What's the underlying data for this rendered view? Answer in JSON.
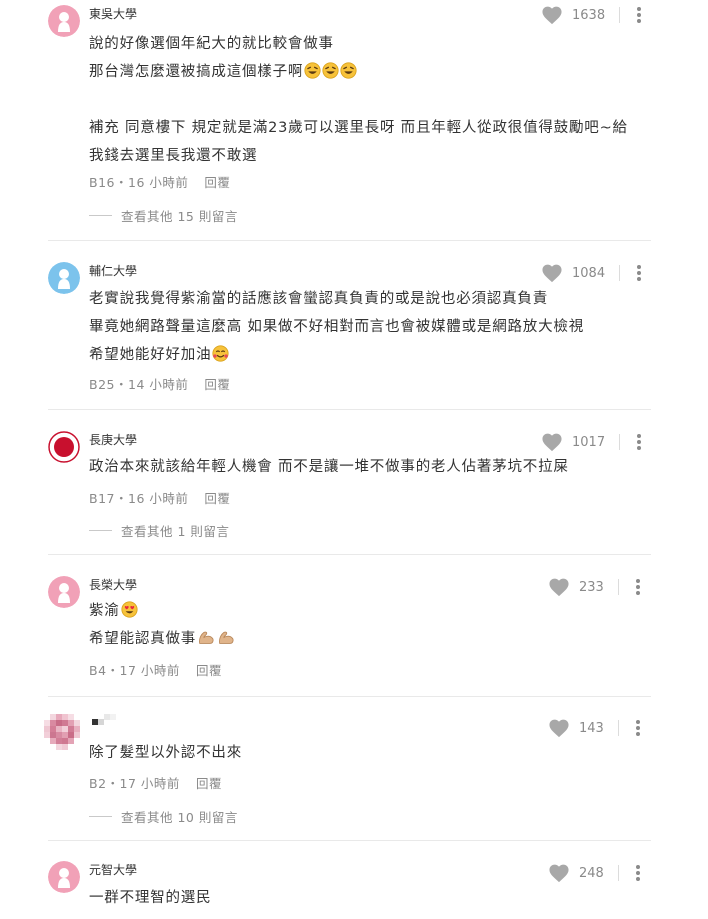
{
  "comments": [
    {
      "author": "東吳大學",
      "likes": "1638",
      "lines": [
        "說的好像選個年紀大的就比較會做事",
        "那台灣怎麼還被搞成這個樣子啊",
        "",
        "補充 同意樓下 規定就是滿23歲可以選里長呀 而且年輕人從政很值得鼓勵吧~給",
        "我錢去選里長我還不敢選"
      ],
      "floor": "B16",
      "time": "16 小時前",
      "reply_label": "回覆",
      "more_replies": "查看其他 15 則留言",
      "emoji": "rofl-emoji"
    },
    {
      "author": "輔仁大學",
      "likes": "1084",
      "lines": [
        "老實說我覺得紫渝當的話應該會蠻認真負責的或是說也必須認真負責",
        "畢竟她網路聲量這麼高 如果做不好相對而言也會被媒體或是網路放大檢視",
        "希望她能好好加油"
      ],
      "floor": "B25",
      "time": "14 小時前",
      "reply_label": "回覆",
      "emoji": "smiling-face-hearts-emoji"
    },
    {
      "author": "長庚大學",
      "likes": "1017",
      "lines": [
        "政治本來就該給年輕人機會 而不是讓一堆不做事的老人佔著茅坑不拉屎"
      ],
      "floor": "B17",
      "time": "16 小時前",
      "reply_label": "回覆",
      "more_replies": "查看其他 1 則留言"
    },
    {
      "author": "長榮大學",
      "likes": "233",
      "lines": [
        "紫渝",
        "希望能認真做事"
      ],
      "floor": "B4",
      "time": "17 小時前",
      "reply_label": "回覆",
      "emoji": "heart-eyes-emoji",
      "emoji2": "flexed-biceps-emoji"
    },
    {
      "author": "",
      "likes": "143",
      "lines": [
        "除了髮型以外認不出來"
      ],
      "floor": "B2",
      "time": "17 小時前",
      "reply_label": "回覆",
      "more_replies": "查看其他 10 則留言"
    },
    {
      "author": "元智大學",
      "likes": "248",
      "lines": [
        "一群不理智的選民"
      ],
      "floor": "",
      "time": "",
      "reply_label": ""
    }
  ],
  "sep": "・",
  "colors": {
    "avatar_pink": "#f1a1b7",
    "avatar_blue": "#7cc3ec",
    "avatar_red": "#c8102e",
    "heart": "#a8a8a8",
    "muted": "#8a8a8a"
  }
}
